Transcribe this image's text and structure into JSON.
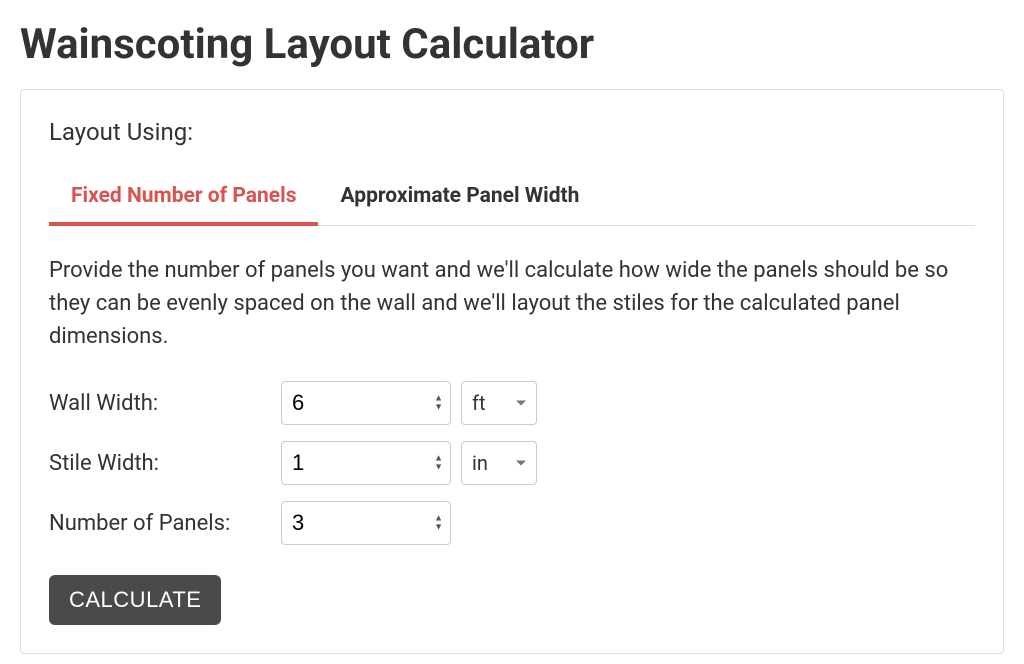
{
  "title": "Wainscoting Layout Calculator",
  "section_label": "Layout Using:",
  "tabs": [
    {
      "label": "Fixed Number of Panels",
      "active": true
    },
    {
      "label": "Approximate Panel Width",
      "active": false
    }
  ],
  "description": "Provide the number of panels you want and we'll calculate how wide the panels should be so they can be evenly spaced on the wall and we'll layout the stiles for the calculated panel dimensions.",
  "fields": {
    "wall_width": {
      "label": "Wall Width:",
      "value": "6",
      "unit": "ft"
    },
    "stile_width": {
      "label": "Stile Width:",
      "value": "1",
      "unit": "in"
    },
    "num_panels": {
      "label": "Number of Panels:",
      "value": "3"
    }
  },
  "calculate_label": "CALCULATE"
}
